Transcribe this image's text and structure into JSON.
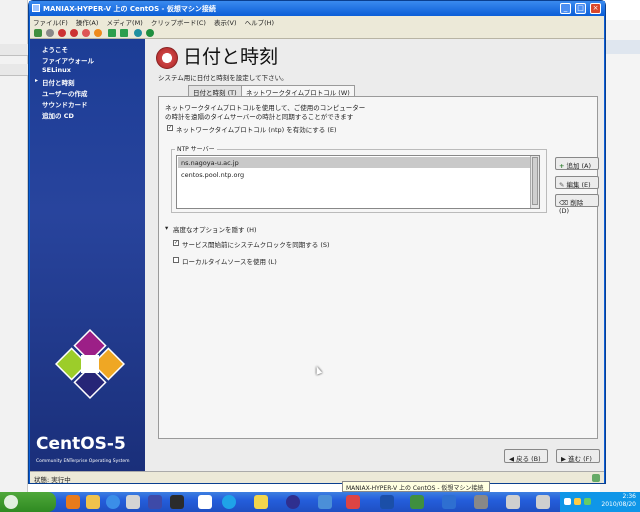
{
  "window": {
    "title": "MANIAX-HYPER-V 上の CentOS - 仮想マシン接続",
    "menu": [
      "ファイル(F)",
      "操作(A)",
      "メディア(M)",
      "クリップボード(C)",
      "表示(V)",
      "ヘルプ(H)"
    ],
    "status": "状態: 実行中"
  },
  "sidebar": {
    "items": [
      {
        "label": "ようこそ",
        "current": false
      },
      {
        "label": "ファイアウォール",
        "current": false
      },
      {
        "label": "SELinux",
        "current": false
      },
      {
        "label": "日付と時刻",
        "current": true
      },
      {
        "label": "ユーザーの作成",
        "current": false
      },
      {
        "label": "サウンドカード",
        "current": false
      },
      {
        "label": "追加の CD",
        "current": false
      }
    ],
    "logo_text": "CentOS-5",
    "logo_sub": "Community ENTerprise Operating System"
  },
  "page": {
    "title": "日付と時刻",
    "subtitle": "システム用に日付と時刻を設定して下さい。",
    "tabs": [
      {
        "label": "日付と時刻 (T)",
        "active": false
      },
      {
        "label": "ネットワークタイムプロトコル (W)",
        "active": true
      }
    ],
    "description": [
      "ネットワークタイムプロトコルを使用して、ご使用のコンピューター",
      "の時計を遠隔のタイムサーバーの時計と同期することができます"
    ],
    "enable_ntp": {
      "label": "ネットワークタイムプロトコル (ntp) を有効にする (E)",
      "checked": true
    },
    "ntp_servers_label": "NTP サーバー",
    "ntp_servers": [
      {
        "name": "ns.nagoya-u.ac.jp",
        "selected": true
      },
      {
        "name": "centos.pool.ntp.org",
        "selected": false
      }
    ],
    "server_buttons": {
      "add": "追加 (A)",
      "edit": "編集 (E)",
      "delete": "削除 (D)"
    },
    "advanced": {
      "label": "高度なオプションを隠す (H)",
      "sync_before": {
        "label": "サービス開始前にシステムクロックを同期する (S)",
        "checked": true
      },
      "local_source": {
        "label": "ローカルタイムソースを使用 (L)",
        "checked": false
      }
    },
    "nav": {
      "back": "戻る (B)",
      "next": "進む (F)"
    }
  },
  "taskbar": {
    "tooltip": "MANIAX-HYPER-V 上の CentOS - 仮想マシン接続",
    "time": "2:36",
    "date": "2010/08/20"
  },
  "colors": {
    "sidebar": "#1c3d96",
    "title_bar": "#0b5ed7",
    "taskbar": "#245edb",
    "start": "#3a962a"
  }
}
